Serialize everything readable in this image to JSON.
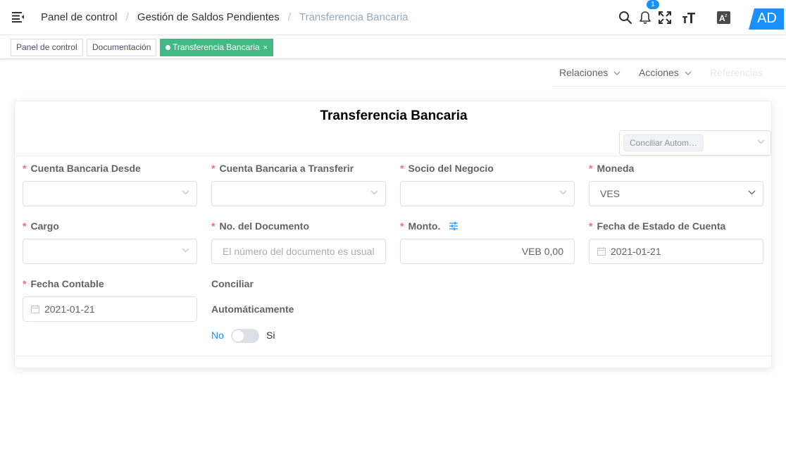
{
  "navbar": {
    "breadcrumb": [
      "Panel de control",
      "Gestión de Saldos Pendientes",
      "Transferencia Bancaria"
    ],
    "notification_count": "1",
    "avatar_initials": "AD"
  },
  "tags_view": {
    "tags": [
      {
        "label": "Panel de control"
      },
      {
        "label": "Documentación"
      },
      {
        "label": "Transferencia Bancaria",
        "close": "×"
      }
    ]
  },
  "menu": {
    "items": [
      "Relaciones",
      "Acciones",
      "Referencias"
    ]
  },
  "form": {
    "title": "Transferencia Bancaria",
    "auto_reconcile_chip": "Conciliar Autom…",
    "required_mark": "*",
    "fields": {
      "cuenta_desde": {
        "label": "Cuenta Bancaria Desde",
        "value": ""
      },
      "cuenta_transferir": {
        "label": "Cuenta Bancaria a Transferir",
        "value": ""
      },
      "socio": {
        "label": "Socio del Negocio",
        "value": ""
      },
      "moneda": {
        "label": "Moneda",
        "value": "VES"
      },
      "cargo": {
        "label": "Cargo",
        "value": ""
      },
      "documento": {
        "label": "No. del Documento",
        "placeholder": "El número del documento es usual"
      },
      "monto": {
        "label": "Monto.",
        "value": "VEB 0,00"
      },
      "fecha_estado": {
        "label": "Fecha de Estado de Cuenta",
        "value": "2021-01-21"
      },
      "fecha_contable": {
        "label": "Fecha Contable",
        "value": "2021-01-21"
      }
    },
    "conciliar": {
      "label_line1": "Conciliar",
      "label_line2": "Automáticamente",
      "off_label": "No",
      "on_label": "Si",
      "enabled": false
    }
  },
  "colors": {
    "primary": "#1890ff",
    "active_tag": "#42b983",
    "required": "#f56c6c"
  }
}
